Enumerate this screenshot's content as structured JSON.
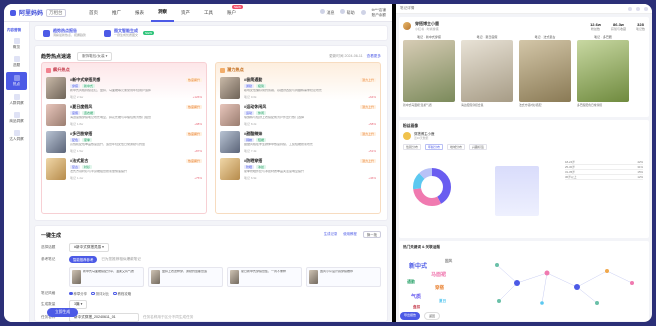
{
  "app": {
    "logo": "阿里妈妈",
    "logo_sub": "万相台"
  },
  "nav": {
    "items": [
      {
        "label": "首页",
        "active": false
      },
      {
        "label": "推广",
        "active": false
      },
      {
        "label": "报表",
        "active": false
      },
      {
        "label": "洞察",
        "active": true
      },
      {
        "label": "资产",
        "active": false
      },
      {
        "label": "工具",
        "active": false
      },
      {
        "label": "账户",
        "active": false,
        "hot": "NEW"
      }
    ],
    "right": {
      "msg": "消息",
      "help": "帮助",
      "user_name": "tb***店铺",
      "user_id": "账户余额"
    }
  },
  "sidebar": {
    "title": "内容营销",
    "items": [
      {
        "label": "概览",
        "active": false
      },
      {
        "label": "选题",
        "active": false
      },
      {
        "label": "热点",
        "active": true
      },
      {
        "label": "人群洞察",
        "active": false
      },
      {
        "label": "商品洞察",
        "active": false
      },
      {
        "label": "达人洞察",
        "active": false
      }
    ]
  },
  "promo": {
    "items": [
      {
        "title": "趋势热点报告",
        "desc": "洞察最新热点，把握趋势"
      },
      {
        "title": "图文智能生成",
        "desc": "一键生成优质图文",
        "badge": "NEW"
      }
    ]
  },
  "hot": {
    "title": "趋势热点速递",
    "select": "服饰鞋包/女装",
    "date": "更新时间 2024-06-11",
    "more": "查看更多",
    "columns": [
      {
        "title": "飙升热点",
        "items": [
          {
            "name": "#新中式穿搭灵感",
            "tag": "热度飙升",
            "chips": [
              "穿搭",
              "新中式"
            ],
            "desc": "新中式风格持续走红，盘扣、马面裙等元素受到年轻用户追捧",
            "meta": "笔记 2.3w",
            "stat": "+126%"
          },
          {
            "name": "#夏日度假风",
            "tag": "热度飙升",
            "chips": [
              "度假",
              "连衣裙"
            ],
            "desc": "海边度假穿搭笔记增长明显，碎花长裙与草编包成为热门组合",
            "meta": "笔记 1.8w",
            "stat": "+98%"
          },
          {
            "name": "#多巴胺穿搭",
            "tag": "热度飙升",
            "chips": [
              "配色",
              "夏季"
            ],
            "desc": "高饱和配色单品热度回升，适合年轻女性日常通勤与约会",
            "meta": "笔记 1.5w",
            "stat": "+87%"
          },
          {
            "name": "#法式复古",
            "tag": "热度飙升",
            "chips": [
              "复古",
              "衬衫"
            ],
            "desc": "法式方领衬衫与半身裙组合搜索量快速提升",
            "meta": "笔记 1.2w",
            "stat": "+75%"
          }
        ]
      },
      {
        "title": "潜力热点",
        "items": [
          {
            "name": "#极简通勤",
            "tag": "潜力上升",
            "chips": [
              "通勤",
              "极简"
            ],
            "desc": "职场女性偏好简约剪裁，基础款西装与阔腿裤需求稳定增长",
            "meta": "笔记 9.6k",
            "stat": "+64%"
          },
          {
            "name": "#运动休闲风",
            "tag": "潜力上升",
            "chips": [
              "运动",
              "休闲"
            ],
            "desc": "瑜伽裤与短款上衣搭配成为户外出行热门选择",
            "meta": "笔记 8.2k",
            "stat": "+58%"
          },
          {
            "name": "#甜酷辣妹",
            "tag": "潜力上升",
            "chips": [
              "辣妹",
              "短裙"
            ],
            "desc": "甜酷风格在学生群体中热度持续，工装短裙搜索增长",
            "meta": "笔记 7.4k",
            "stat": "+51%"
          },
          {
            "name": "#防晒穿搭",
            "tag": "潜力上升",
            "chips": [
              "防晒",
              "冰丝"
            ],
            "desc": "夏季防晒外套与冰丝材质单品关注度明显提升",
            "meta": "笔记 6.9k",
            "stat": "+46%"
          }
        ]
      }
    ]
  },
  "gen": {
    "title": "一键生成",
    "links": [
      "生成记录",
      "使用教程"
    ],
    "refresh": "换一批",
    "rows": {
      "topic_label": "选择话题",
      "topic_value": "#新中式穿搭灵感",
      "ref_label": "参考笔记",
      "ref_pill": "智能推荐参考",
      "ref_hint": "已为您推荐相似爆款笔记",
      "refs": [
        "新中式马面裙搭配分享，温柔又有气质",
        "盘扣上衣这样穿，通勤约会都合适",
        "夏日新中式穿搭合集，一周不重样",
        "国风小众设计感穿搭推荐"
      ],
      "style_label": "笔记风格",
      "style_options": [
        "种草分享",
        "测评对比",
        "教程攻略"
      ],
      "count_label": "生成数量",
      "count_value": "3篇",
      "name_label": "任务名称",
      "name_value": "新中式穿搭_20240611_01",
      "name_hint": "任务名称用于区分不同生成任务"
    },
    "submit": "立即生成"
  },
  "right": {
    "top_title": "笔记详情",
    "account": {
      "name": "穿搭博主小鹿",
      "sub": "小红书 · 时尚穿搭",
      "stats": [
        {
          "label": "粉丝数",
          "value": "12.6w"
        },
        {
          "label": "获赞与收藏",
          "value": "86.3w"
        },
        {
          "label": "笔记数",
          "value": "328"
        }
      ]
    },
    "notes": [
      {
        "label": "笔记 · 新中式穿搭",
        "cap": "新中式马面裙 温柔气质"
      },
      {
        "label": "笔记 · 夏日度假",
        "cap": "海边度假穿搭合集"
      },
      {
        "label": "笔记 · 法式复古",
        "cap": "法式方领衬衫搭配"
      },
      {
        "label": "笔记 · 多巴胺",
        "cap": "多巴胺配色日常穿搭"
      }
    ],
    "audience": {
      "title": "粉丝画像",
      "user_name": "穿搭博主小鹿",
      "user_sub": "近30天数据",
      "tabs": [
        "性别分布",
        "年龄分布",
        "地域分布",
        "兴趣标签"
      ],
      "legend": [
        {
          "label": "18-24岁",
          "value": "42%"
        },
        {
          "label": "25-30岁",
          "value": "31%"
        },
        {
          "label": "31-35岁",
          "value": "15%"
        },
        {
          "label": "36岁以上",
          "value": "12%"
        }
      ]
    },
    "cloud": {
      "title": "热门关键词 & 关联话题",
      "words": [
        "新中式",
        "马面裙",
        "通勤",
        "穿搭",
        "气质",
        "夏日",
        "盘扣",
        "国风"
      ]
    },
    "footer": [
      "导出报告",
      "返回"
    ]
  },
  "colors": {
    "accent": "#4c5ae6",
    "hot_red": "#f04f6a",
    "hot_orange": "#e87d2a",
    "bg_outer": "#2b2f77"
  }
}
